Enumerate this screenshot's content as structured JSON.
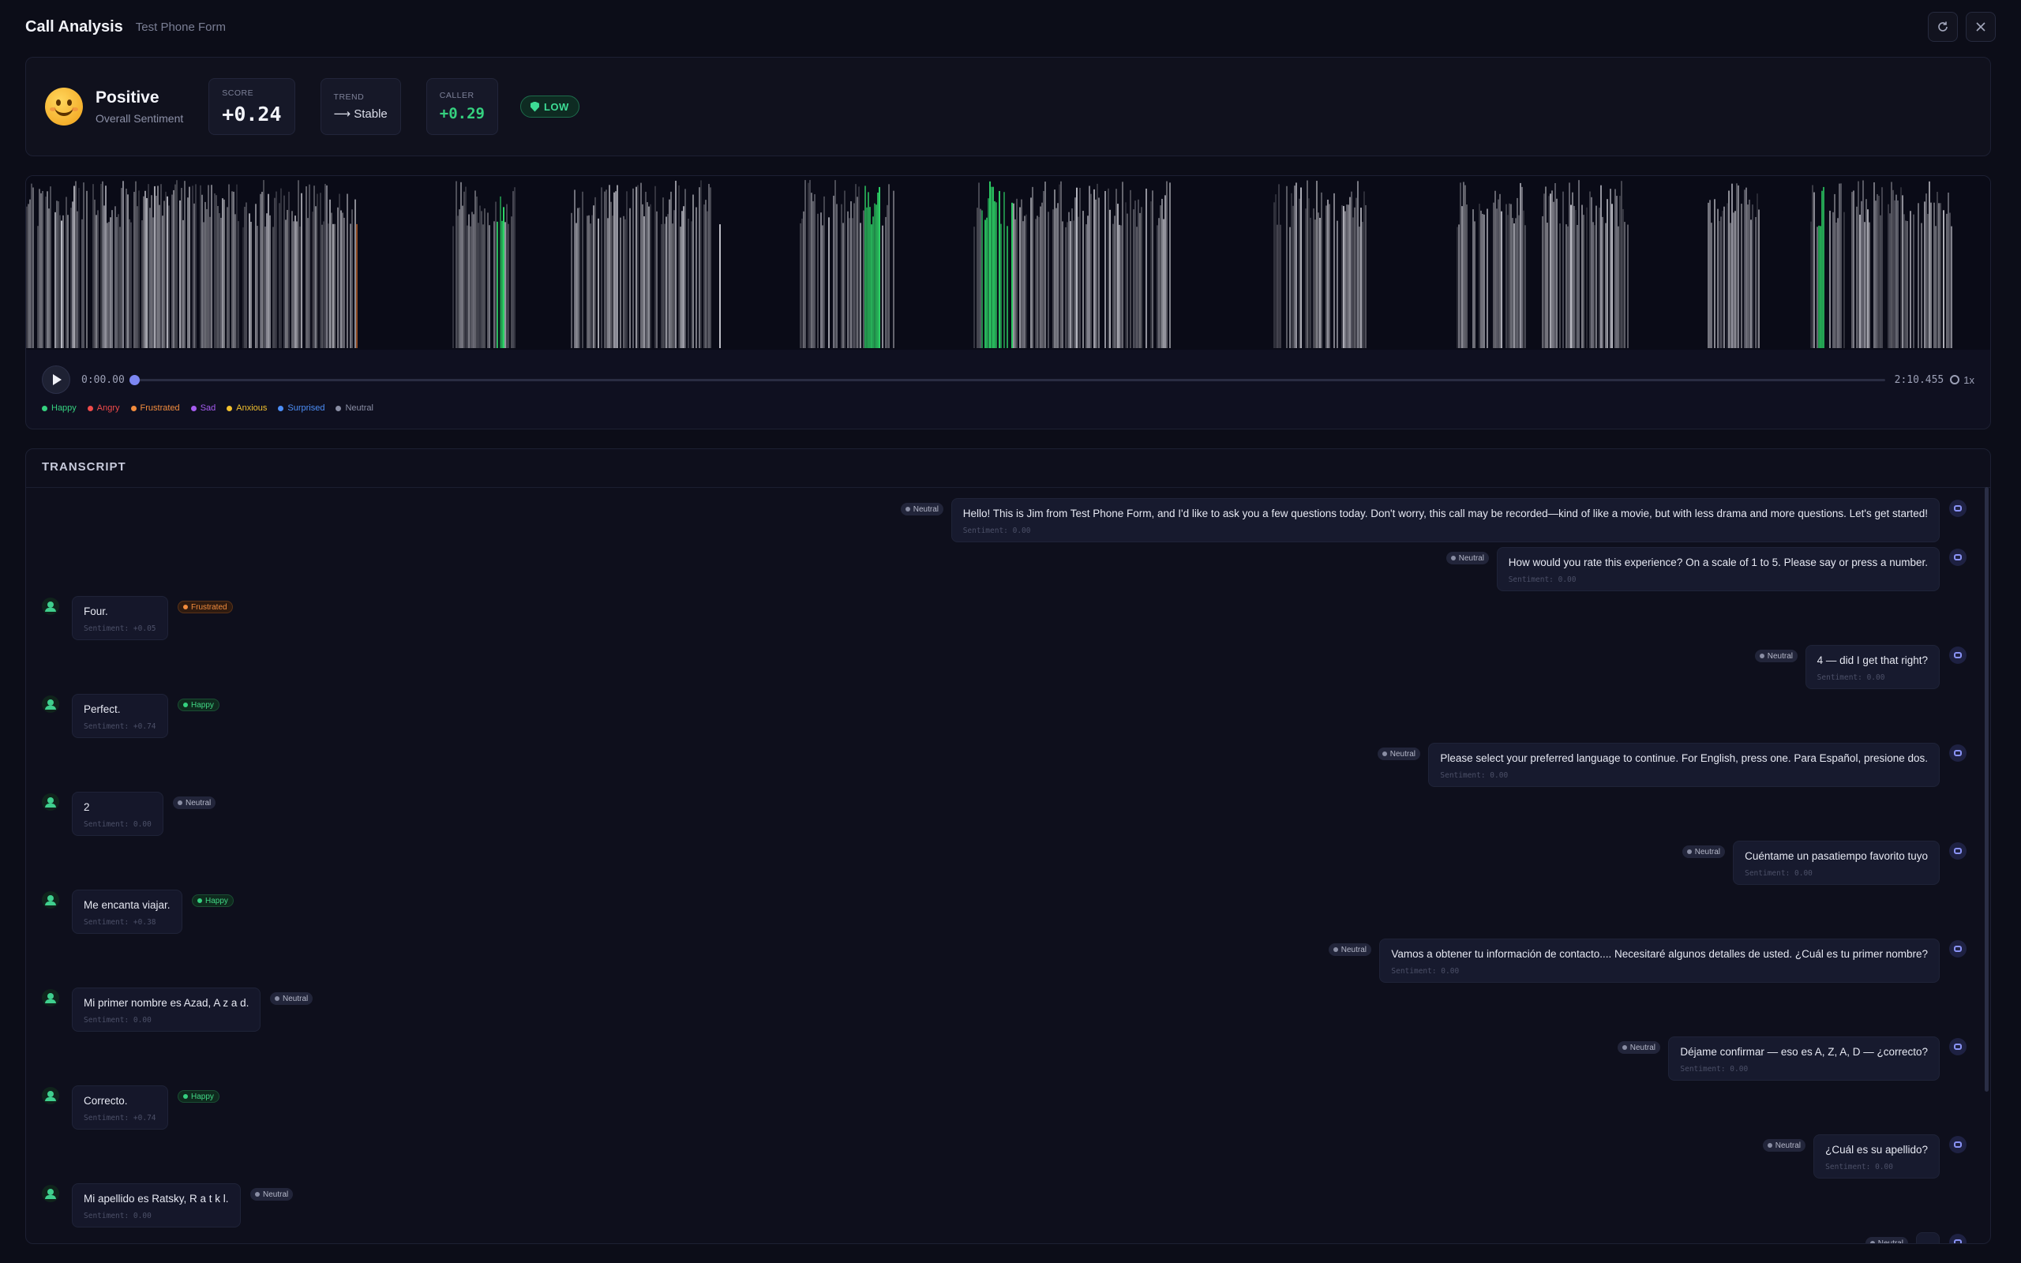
{
  "header": {
    "title": "Call Analysis",
    "subtitle": "Test Phone Form"
  },
  "summary": {
    "sentiment_label": "Positive",
    "sentiment_sub": "Overall Sentiment",
    "score_label": "SCORE",
    "score_value": "+0.24",
    "trend_label": "TREND",
    "trend_value": "⟶ Stable",
    "caller_label": "CALLER",
    "caller_value": "+0.29",
    "risk_label": "LOW"
  },
  "player": {
    "time_current": "0:00.00",
    "time_total": "2:10.455",
    "speed": "1x",
    "progress": 0
  },
  "legend": [
    {
      "label": "Happy",
      "color": "#35d07f"
    },
    {
      "label": "Angry",
      "color": "#ef4a4a"
    },
    {
      "label": "Frustrated",
      "color": "#f28c3d"
    },
    {
      "label": "Sad",
      "color": "#a55cf0"
    },
    {
      "label": "Anxious",
      "color": "#f2c12e"
    },
    {
      "label": "Surprised",
      "color": "#4c8ef7"
    },
    {
      "label": "Neutral",
      "color": "#8a8ea4"
    }
  ],
  "transcript": {
    "title": "TRANSCRIPT",
    "messages": [
      {
        "role": "agent",
        "text": "Hello! This is Jim from Test Phone Form, and I'd like to ask you a few questions today. Don't worry, this call may be recorded—kind of like a movie, but with less drama and more questions. Let's get started!",
        "emotion": "Neutral",
        "score": "Sentiment: 0.00"
      },
      {
        "role": "agent",
        "text": "How would you rate this experience? On a scale of 1 to 5. Please say or press a number.",
        "emotion": "Neutral",
        "score": "Sentiment: 0.00"
      },
      {
        "role": "caller",
        "text": "Four.",
        "emotion": "Frustrated",
        "score": "Sentiment: +0.05"
      },
      {
        "role": "agent",
        "text": "4 — did I get that right?",
        "emotion": "Neutral",
        "score": "Sentiment: 0.00"
      },
      {
        "role": "caller",
        "text": "Perfect.",
        "emotion": "Happy",
        "score": "Sentiment: +0.74"
      },
      {
        "role": "agent",
        "text": "Please select your preferred language to continue. For English, press one. Para Español, presione dos.",
        "emotion": "Neutral",
        "score": "Sentiment: 0.00"
      },
      {
        "role": "caller",
        "text": "2",
        "emotion": "Neutral",
        "score": "Sentiment: 0.00"
      },
      {
        "role": "agent",
        "text": "Cuéntame un pasatiempo favorito tuyo",
        "emotion": "Neutral",
        "score": "Sentiment: 0.00"
      },
      {
        "role": "caller",
        "text": "Me encanta viajar.",
        "emotion": "Happy",
        "score": "Sentiment: +0.38"
      },
      {
        "role": "agent",
        "text": "Vamos a obtener tu información de contacto.... Necesitaré algunos detalles de usted. ¿Cuál es tu primer nombre?",
        "emotion": "Neutral",
        "score": "Sentiment: 0.00"
      },
      {
        "role": "caller",
        "text": "Mi primer nombre es Azad, A z a d.",
        "emotion": "Neutral",
        "score": "Sentiment: 0.00"
      },
      {
        "role": "agent",
        "text": "Déjame confirmar — eso es A, Z, A, D — ¿correcto?",
        "emotion": "Neutral",
        "score": "Sentiment: 0.00"
      },
      {
        "role": "caller",
        "text": "Correcto.",
        "emotion": "Happy",
        "score": "Sentiment: +0.74"
      },
      {
        "role": "agent",
        "text": "¿Cuál es su apellido?",
        "emotion": "Neutral",
        "score": "Sentiment: 0.00"
      },
      {
        "role": "caller",
        "text": "Mi apellido es Ratsky, R a t k l.",
        "emotion": "Neutral",
        "score": "Sentiment: 0.00"
      },
      {
        "role": "agent",
        "text": "",
        "emotion": "Neutral",
        "score": ""
      }
    ]
  }
}
